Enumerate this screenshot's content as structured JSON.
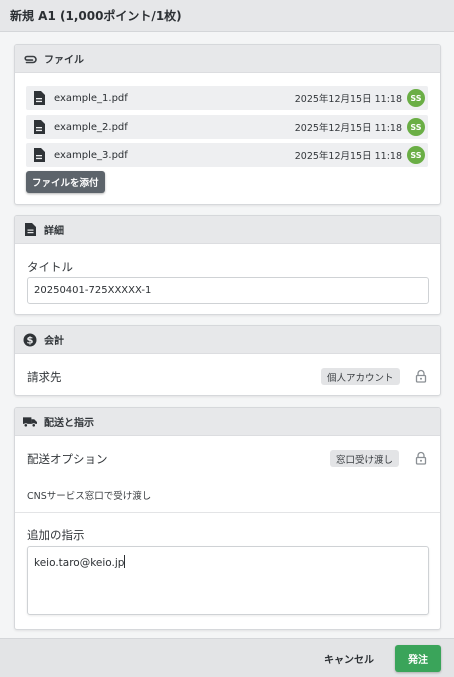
{
  "dialog": {
    "title": "新規 A1 (1,000ポイント/1枚)"
  },
  "files_section": {
    "title": "ファイル",
    "icon": "paperclip-icon",
    "files": [
      {
        "name": "example_1.pdf",
        "date": "2025年12月15日 11:18",
        "user": "SS"
      },
      {
        "name": "example_2.pdf",
        "date": "2025年12月15日 11:18",
        "user": "SS"
      },
      {
        "name": "example_3.pdf",
        "date": "2025年12月15日 11:18",
        "user": "SS"
      }
    ],
    "attach_label": "ファイルを添付"
  },
  "details_section": {
    "title": "詳細",
    "icon": "document-icon",
    "title_label": "タイトル",
    "title_value": "20250401-725XXXXX-1"
  },
  "billing_section": {
    "title": "会計",
    "icon": "dollar-icon",
    "billing_label": "請求先",
    "billing_value": "個人アカウント"
  },
  "delivery_section": {
    "title": "配送と指示",
    "icon": "truck-icon",
    "option_label": "配送オプション",
    "option_value": "窓口受け渡し",
    "option_description": "CNSサービス窓口で受け渡し",
    "instructions_label": "追加の指示",
    "instructions_value": "keio.taro@keio.jp"
  },
  "footer": {
    "cancel_label": "キャンセル",
    "submit_label": "発注"
  },
  "colors": {
    "avatar": "#6aae45",
    "submit": "#3aa45a",
    "attach_button": "#5d646b"
  }
}
